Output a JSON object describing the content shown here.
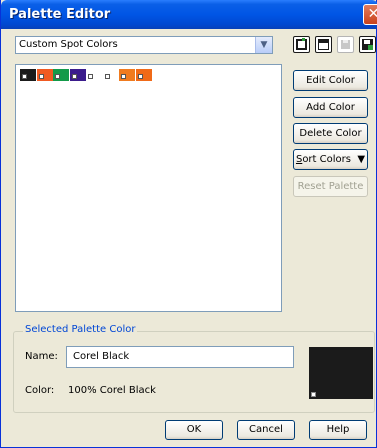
{
  "window": {
    "title": "Palette Editor"
  },
  "palette_select": {
    "value": "Custom Spot Colors"
  },
  "swatches": [
    {
      "name": "Corel Black",
      "color": "#1b1b1b"
    },
    {
      "name": "",
      "color": "#f05a22"
    },
    {
      "name": "",
      "color": "#139a49"
    },
    {
      "name": "",
      "color": "#3b1c8c"
    },
    {
      "name": "",
      "color": "#ffffff"
    },
    {
      "name": "",
      "color": "#ffffff"
    },
    {
      "name": "",
      "color": "#f07b1f"
    },
    {
      "name": "",
      "color": "#f06a18"
    }
  ],
  "buttons": {
    "edit_color": "Edit Color",
    "add_color": "Add Color",
    "delete_color": "Delete Color",
    "sort_colors": "ort Colors",
    "sort_colors_mnemonic": "S",
    "reset_palette": "Reset Palette"
  },
  "selected": {
    "group_label": "Selected Palette Color",
    "name_label": "Name:",
    "name_value": "Corel Black",
    "color_label": "Color:",
    "color_value": "100%  Corel Black",
    "preview_color": "#1b1b1b"
  },
  "footer": {
    "ok": "OK",
    "cancel": "Cancel",
    "help": "Help"
  },
  "icons": [
    "new-palette-icon",
    "open-palette-icon",
    "save-palette-icon",
    "save-as-palette-icon"
  ]
}
